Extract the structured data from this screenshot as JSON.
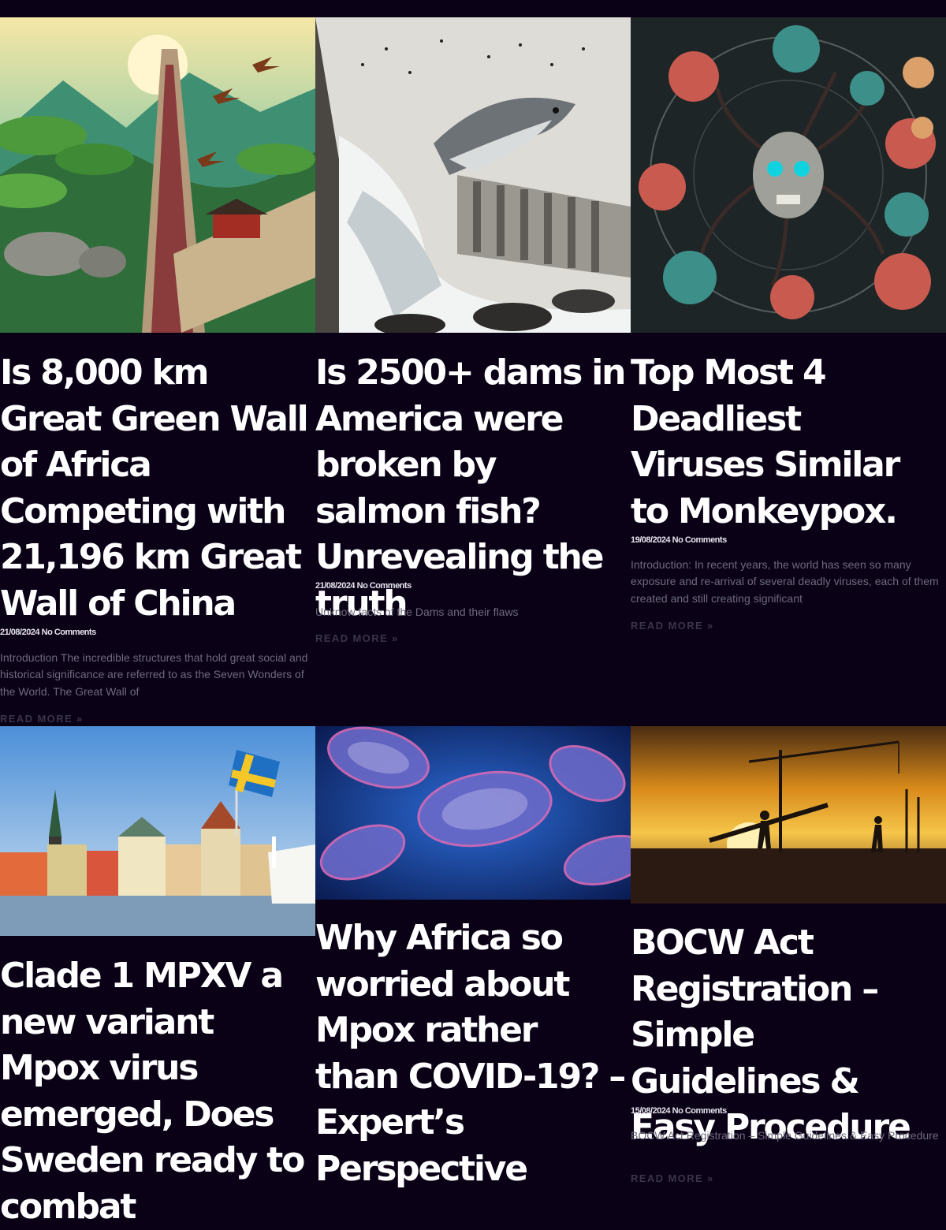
{
  "posts": [
    {
      "title": "Is 8,000 km Great Green Wall of Africa Competing with 21,196 km Great Wall of China",
      "date": "21/08/2024",
      "comments": "No Comments",
      "excerpt": "Introduction The incredible structures that hold great social and historical significance are referred to as the Seven Wonders of the World. The Great Wall of",
      "read_more": "READ MORE »"
    },
    {
      "title": "Is 2500+ dams in America were broken by salmon fish? Unrevealing the truth",
      "date": "21/08/2024",
      "comments": "No Comments",
      "excerpt": "Unknow facts of the Dams and their flaws",
      "read_more": "READ MORE »"
    },
    {
      "title": "Top Most 4 Deadliest Viruses Similar to Monkeypox.",
      "date": "19/08/2024",
      "comments": "No Comments",
      "excerpt": "Introduction: In recent years, the world has seen so many exposure and re-arrival of several deadly viruses, each of them created and still creating significant",
      "read_more": "READ MORE »"
    },
    {
      "title": "Clade 1 MPXV a new variant Mpox virus emerged, Does Sweden ready to combat",
      "date": "",
      "comments": "",
      "excerpt": "",
      "read_more": ""
    },
    {
      "title": "Why Africa so worried about Mpox rather than COVID-19? – Expert’s Perspective",
      "date": "",
      "comments": "",
      "excerpt": "",
      "read_more": ""
    },
    {
      "title": "BOCW Act Registration – Simple Guidelines & Easy Procedure",
      "date": "15/08/2024",
      "comments": "No Comments",
      "excerpt": "BOCW Act Registration – Simple Guidelines & Easy Procedure",
      "read_more": "READ MORE »"
    }
  ]
}
